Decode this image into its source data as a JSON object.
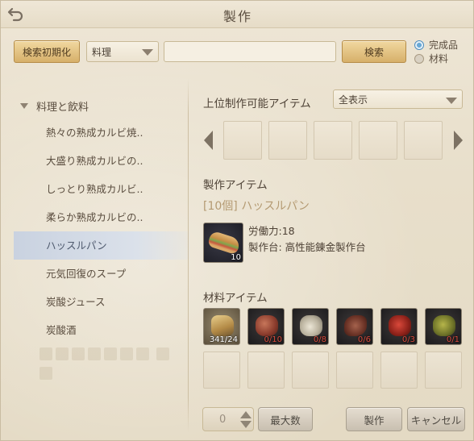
{
  "window": {
    "title": "製作"
  },
  "search": {
    "reset_label": "検索初期化",
    "category_selected": "料理",
    "keyword_value": "",
    "search_label": "検索",
    "radio_options": [
      {
        "label": "完成品",
        "selected": true
      },
      {
        "label": "材料",
        "selected": false
      }
    ]
  },
  "recipes": {
    "category": "料理と飲料",
    "items": [
      {
        "label": "熱々の熟成カルビ焼..",
        "selected": false
      },
      {
        "label": "大盛り熟成カルビの..",
        "selected": false
      },
      {
        "label": "しっとり熟成カルビ..",
        "selected": false
      },
      {
        "label": "柔らか熟成カルビの..",
        "selected": false
      },
      {
        "label": "ハッスルパン",
        "selected": true
      },
      {
        "label": "元気回復のスープ",
        "selected": false
      },
      {
        "label": "炭酸ジュース",
        "selected": false
      },
      {
        "label": "炭酸酒",
        "selected": false
      }
    ]
  },
  "upper": {
    "label": "上位制作可能アイテム",
    "filter_selected": "全表示"
  },
  "product": {
    "section_label": "製作アイテム",
    "name": "[10個] ハッスルパン",
    "icon": "sandwich-icon",
    "quantity": "10",
    "labor": "労働力:18",
    "workbench": "製作台: 高性能錬金製作台"
  },
  "materials": {
    "section_label": "材料アイテム",
    "items": [
      {
        "icon": "bread-icon",
        "count": "341/24",
        "enough": true
      },
      {
        "icon": "meat-icon",
        "count": "0/10",
        "enough": false
      },
      {
        "icon": "garlic-icon",
        "count": "0/8",
        "enough": false
      },
      {
        "icon": "beans-icon",
        "count": "0/6",
        "enough": false
      },
      {
        "icon": "berries-icon",
        "count": "0/3",
        "enough": false
      },
      {
        "icon": "olive-icon",
        "count": "0/1",
        "enough": false
      }
    ]
  },
  "controls": {
    "amount": "0",
    "max_label": "最大数",
    "craft_label": "製作",
    "cancel_label": "キャンセル"
  }
}
